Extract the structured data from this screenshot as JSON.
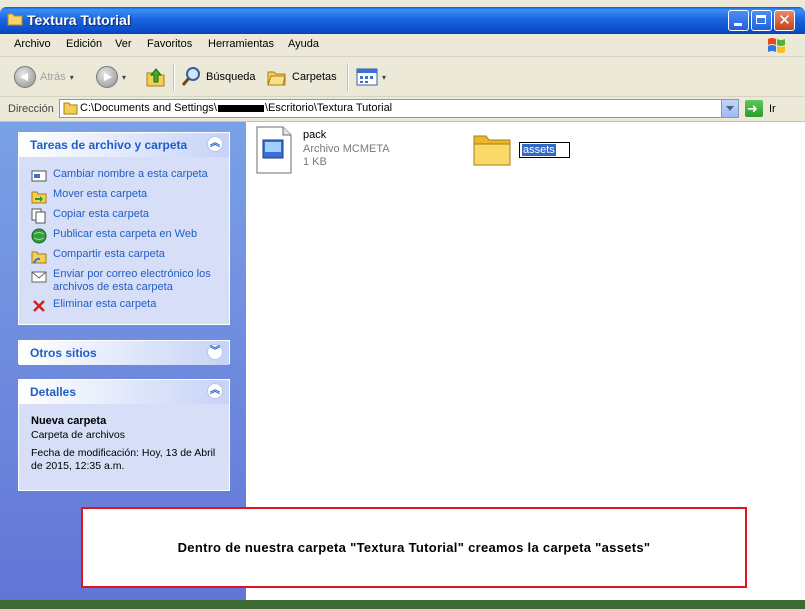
{
  "window": {
    "title": "Textura Tutorial"
  },
  "menu": {
    "items": [
      "Archivo",
      "Edición",
      "Ver",
      "Favoritos",
      "Herramientas",
      "Ayuda"
    ]
  },
  "toolbar": {
    "back_label": "Atrás",
    "search_label": "Búsqueda",
    "folders_label": "Carpetas"
  },
  "address": {
    "label": "Dirección",
    "path_start": "C:\\Documents and Settings\\",
    "path_end": "\\Escritorio\\Textura Tutorial",
    "go_label": "Ir"
  },
  "sidebar": {
    "tasks": {
      "title": "Tareas de archivo y carpeta",
      "items": [
        {
          "label": "Cambiar nombre a esta carpeta",
          "icon": "rename-icon"
        },
        {
          "label": "Mover esta carpeta",
          "icon": "move-folder-icon"
        },
        {
          "label": "Copiar esta carpeta",
          "icon": "copy-icon"
        },
        {
          "label": "Publicar esta carpeta en Web",
          "icon": "globe-icon"
        },
        {
          "label": "Compartir esta carpeta",
          "icon": "share-folder-icon"
        },
        {
          "label": "Enviar por correo electrónico los archivos de esta carpeta",
          "icon": "email-icon"
        },
        {
          "label": "Eliminar esta carpeta",
          "icon": "delete-icon"
        }
      ]
    },
    "other_places": {
      "title": "Otros sitios"
    },
    "details": {
      "title": "Detalles",
      "name": "Nueva carpeta",
      "type": "Carpeta de archivos",
      "modified": "Fecha de modificación: Hoy, 13 de Abril de 2015, 12:35 a.m."
    }
  },
  "files": [
    {
      "name": "pack",
      "type": "Archivo MCMETA",
      "size": "1 KB"
    }
  ],
  "folder": {
    "rename_value": "assets"
  },
  "annotation": {
    "text": "Dentro de nuestra carpeta \"Textura Tutorial\" creamos la carpeta \"assets\""
  },
  "colors": {
    "titlebar": "#0b4fcc",
    "sidebar_link": "#215dc6",
    "annotation_border": "#e0141e"
  }
}
